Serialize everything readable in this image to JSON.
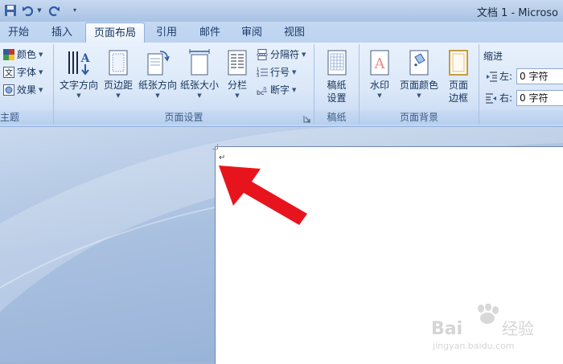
{
  "window": {
    "title": "文档 1 - Microso"
  },
  "tabs": [
    {
      "label": "开始"
    },
    {
      "label": "插入"
    },
    {
      "label": "页面布局"
    },
    {
      "label": "引用"
    },
    {
      "label": "邮件"
    },
    {
      "label": "审阅"
    },
    {
      "label": "视图"
    }
  ],
  "ribbon": {
    "theme": {
      "colors": "颜色",
      "fonts": "字体",
      "effects": "效果",
      "group_label": "主题"
    },
    "page_setup": {
      "text_direction": "文字方向",
      "margins": "页边距",
      "orientation": "纸张方向",
      "size": "纸张大小",
      "columns": "分栏",
      "breaks": "分隔符",
      "line_numbers": "行号",
      "hyphenation": "断字",
      "group_label": "页面设置"
    },
    "manuscript": {
      "setup_line1": "稿纸",
      "setup_line2": "设置",
      "group_label": "稿纸"
    },
    "page_background": {
      "watermark": "水印",
      "page_color": "页面颜色",
      "borders_line1": "页面",
      "borders_line2": "边框",
      "group_label": "页面背景"
    },
    "paragraph": {
      "indent_title": "缩进",
      "left_label": "左:",
      "left_value": "0 字符",
      "right_label": "右:",
      "right_value": "0 字符"
    }
  },
  "document": {
    "paragraph_mark": "↵"
  },
  "watermark": {
    "line1": "Bai",
    "line2": "经验",
    "url": "jingyan.baidu.com"
  },
  "colors": {
    "accent_arrow": "#e8141d",
    "ribbon_blue": "#dbe8f8",
    "workspace_blue": "#a9c0e0"
  },
  "icons": [
    "save-icon",
    "undo-icon",
    "redo-icon",
    "theme-colors-icon",
    "theme-fonts-icon",
    "theme-effects-icon",
    "text-direction-icon",
    "margins-icon",
    "orientation-icon",
    "paper-size-icon",
    "columns-icon",
    "breaks-icon",
    "line-numbers-icon",
    "hyphenation-icon",
    "manuscript-icon",
    "watermark-icon",
    "page-color-icon",
    "page-borders-icon",
    "indent-left-icon",
    "indent-right-icon",
    "dialog-launcher-icon"
  ]
}
